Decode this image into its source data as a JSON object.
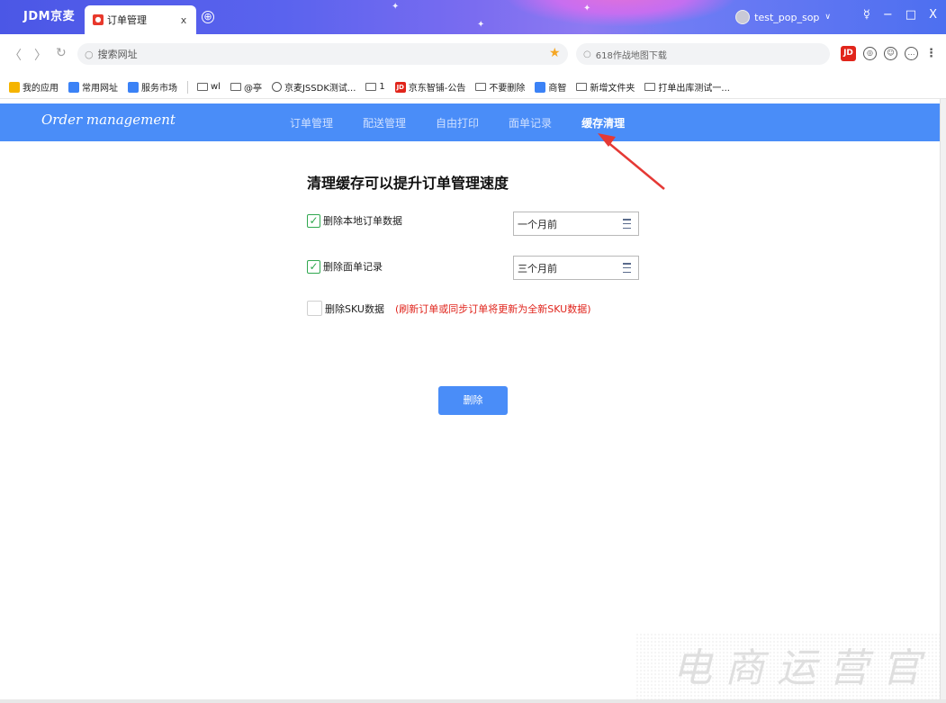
{
  "browser": {
    "app_name": "JDM京麦",
    "tab": {
      "label": "订单管理",
      "close": "x"
    },
    "newtab": "⊕",
    "user": {
      "name": "test_pop_sop"
    },
    "window_controls": [
      "☿",
      "−",
      "□",
      "X"
    ]
  },
  "address": {
    "url_placeholder": "搜索网址",
    "search_text": "618作战地图下载",
    "nav": {
      "back": "〈",
      "forward": "〉",
      "refresh": "↻"
    },
    "jd_badge": "JD"
  },
  "bookmarks": [
    {
      "label": "我的应用",
      "icon": "app-icon",
      "color": "#f5b400"
    },
    {
      "label": "常用网址",
      "icon": "blue-square-icon",
      "color": "#3b82f6"
    },
    {
      "label": "服务市场",
      "icon": "blue-square-icon",
      "color": "#3b82f6"
    },
    {
      "label": "wl",
      "icon": "folder-icon"
    },
    {
      "label": "@亭",
      "icon": "folder-icon"
    },
    {
      "label": "京麦JSSDK测试...",
      "icon": "globe-icon"
    },
    {
      "label": "1",
      "icon": "folder-icon"
    },
    {
      "label": "京东智铺-公告",
      "icon": "jd-icon"
    },
    {
      "label": "不要删除",
      "icon": "folder-icon"
    },
    {
      "label": "商智",
      "icon": "blue-square-icon",
      "color": "#3b82f6"
    },
    {
      "label": "新增文件夹",
      "icon": "folder-icon"
    },
    {
      "label": "打单出库测试一...",
      "icon": "folder-icon"
    }
  ],
  "app": {
    "logo": "Order management",
    "nav": [
      "订单管理",
      "配送管理",
      "自由打印",
      "面单记录",
      "缓存清理"
    ],
    "active_nav": "缓存清理",
    "accent": "#4a8df8"
  },
  "content": {
    "heading": "清理缓存可以提升订单管理速度",
    "options": [
      {
        "label": "删除本地订单数据",
        "checked": true,
        "select": "一个月前"
      },
      {
        "label": "删除面单记录",
        "checked": true,
        "select": "三个月前"
      },
      {
        "label": "删除SKU数据",
        "checked": false,
        "hint": "(刷新订单或同步订单将更新为全新SKU数据)"
      }
    ],
    "delete_button": "删除",
    "check_mark": "✓"
  },
  "watermark": "电商运营官"
}
